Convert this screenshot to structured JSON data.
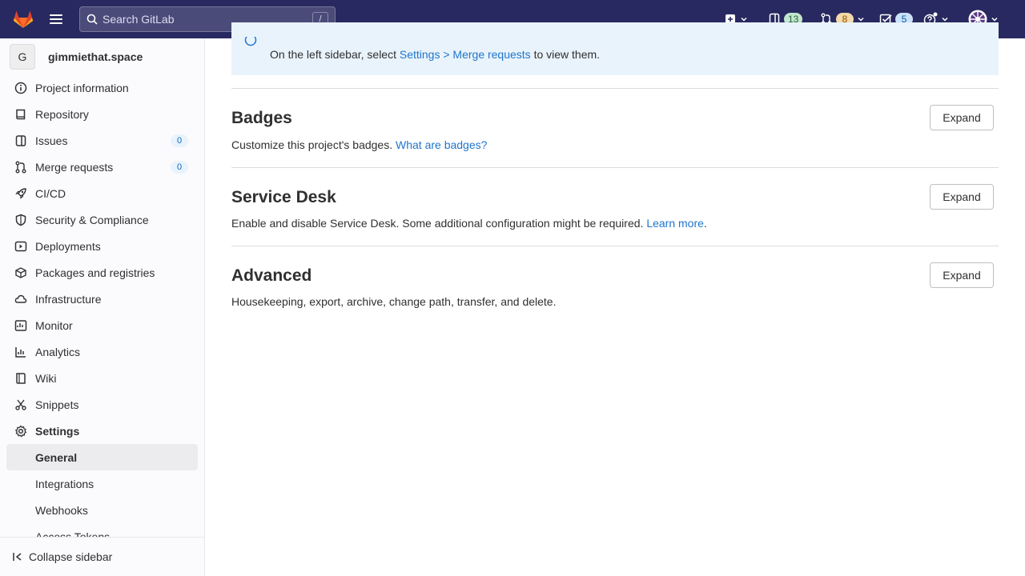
{
  "topbar": {
    "search_placeholder": "Search GitLab",
    "search_shortcut": "/",
    "issues_count": "13",
    "merge_requests_count": "8",
    "todos_count": "5",
    "colors": {
      "bar": "#292961",
      "issues_pill": "#c3e6cd",
      "mr_pill": "#f5d9a8",
      "todo_pill": "#cbe2f9"
    }
  },
  "sidebar": {
    "project_initial": "G",
    "project_name": "gimmiethat.space",
    "items": [
      {
        "label": "Project information",
        "icon": "info-icon"
      },
      {
        "label": "Repository",
        "icon": "book-icon"
      },
      {
        "label": "Issues",
        "icon": "issues-icon",
        "count": "0"
      },
      {
        "label": "Merge requests",
        "icon": "merge-request-icon",
        "count": "0"
      },
      {
        "label": "CI/CD",
        "icon": "rocket-icon"
      },
      {
        "label": "Security & Compliance",
        "icon": "shield-icon"
      },
      {
        "label": "Deployments",
        "icon": "deployments-icon"
      },
      {
        "label": "Packages and registries",
        "icon": "package-icon"
      },
      {
        "label": "Infrastructure",
        "icon": "cloud-icon"
      },
      {
        "label": "Monitor",
        "icon": "monitor-icon"
      },
      {
        "label": "Analytics",
        "icon": "chart-icon"
      },
      {
        "label": "Wiki",
        "icon": "wiki-icon"
      },
      {
        "label": "Snippets",
        "icon": "snippet-icon"
      },
      {
        "label": "Settings",
        "icon": "gear-icon"
      }
    ],
    "settings_sub": [
      {
        "label": "General",
        "active": true
      },
      {
        "label": "Integrations"
      },
      {
        "label": "Webhooks"
      },
      {
        "label": "Access Tokens"
      }
    ],
    "collapse_label": "Collapse sidebar"
  },
  "main": {
    "alert": {
      "body_prefix": "On the left sidebar, select ",
      "body_link": "Settings > Merge requests",
      "body_suffix": " to view them."
    },
    "sections": [
      {
        "title": "Badges",
        "desc": "Customize this project's badges. ",
        "link": "What are badges?",
        "suffix": "",
        "button": "Expand"
      },
      {
        "title": "Service Desk",
        "desc": "Enable and disable Service Desk. Some additional configuration might be required. ",
        "link": "Learn more",
        "suffix": ".",
        "button": "Expand"
      },
      {
        "title": "Advanced",
        "desc": "Housekeeping, export, archive, change path, transfer, and delete.",
        "link": "",
        "suffix": "",
        "button": "Expand"
      }
    ]
  }
}
